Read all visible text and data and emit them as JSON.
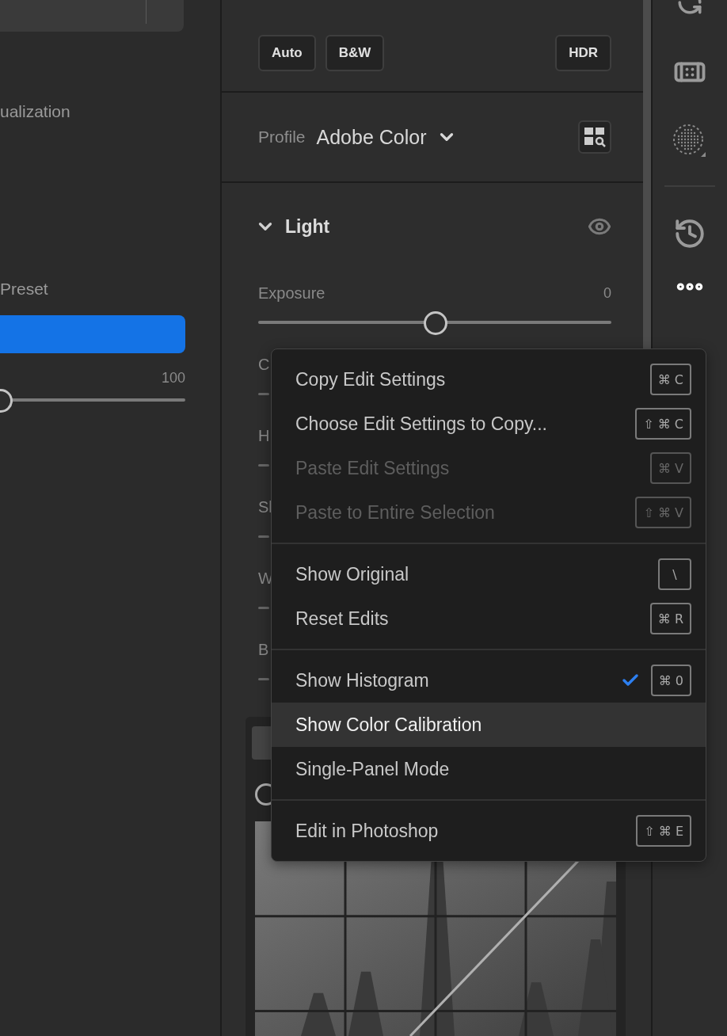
{
  "left_panel": {
    "section_label": "ualization",
    "preset_label": "Preset",
    "amount": {
      "reading": "100",
      "level": 0
    }
  },
  "edit": {
    "buttons": [
      "Auto",
      "B&W"
    ],
    "hdr_button": "HDR"
  },
  "profile": {
    "label": "Profile",
    "value": "Adobe Color"
  },
  "light": {
    "title": "Light",
    "expanded": true,
    "sliders": [
      {
        "label": "Exposure",
        "reading": "0",
        "level": 0.5
      },
      {
        "label": "C"
      },
      {
        "label": "H"
      },
      {
        "label": "Sl"
      },
      {
        "label": "W"
      },
      {
        "label": "B"
      }
    ]
  },
  "menu": {
    "groups": [
      [
        {
          "label": "Copy Edit Settings",
          "shortcut": "⌘ C",
          "disabled": false,
          "checked": false,
          "selected": false
        },
        {
          "label": "Choose Edit Settings to Copy...",
          "shortcut": "⇧ ⌘ C",
          "disabled": false,
          "checked": false,
          "selected": false
        },
        {
          "label": "Paste Edit Settings",
          "shortcut": "⌘ V",
          "disabled": true,
          "checked": false,
          "selected": false
        },
        {
          "label": "Paste to Entire Selection",
          "shortcut": "⇧ ⌘ V",
          "disabled": true,
          "checked": false,
          "selected": false
        }
      ],
      [
        {
          "label": "Show Original",
          "shortcut": "\\",
          "disabled": false,
          "checked": false,
          "selected": false
        },
        {
          "label": "Reset Edits",
          "shortcut": "⌘ R",
          "disabled": false,
          "checked": false,
          "selected": false
        }
      ],
      [
        {
          "label": "Show Histogram",
          "shortcut": "⌘ 0",
          "disabled": false,
          "checked": true,
          "selected": false
        },
        {
          "label": "Show Color Calibration",
          "disabled": false,
          "checked": false,
          "selected": true
        },
        {
          "label": "Single-Panel Mode",
          "disabled": false,
          "checked": false,
          "selected": false
        }
      ],
      [
        {
          "label": "Edit in Photoshop",
          "shortcut": "⇧ ⌘ E",
          "disabled": false,
          "checked": false,
          "selected": false
        }
      ]
    ]
  }
}
